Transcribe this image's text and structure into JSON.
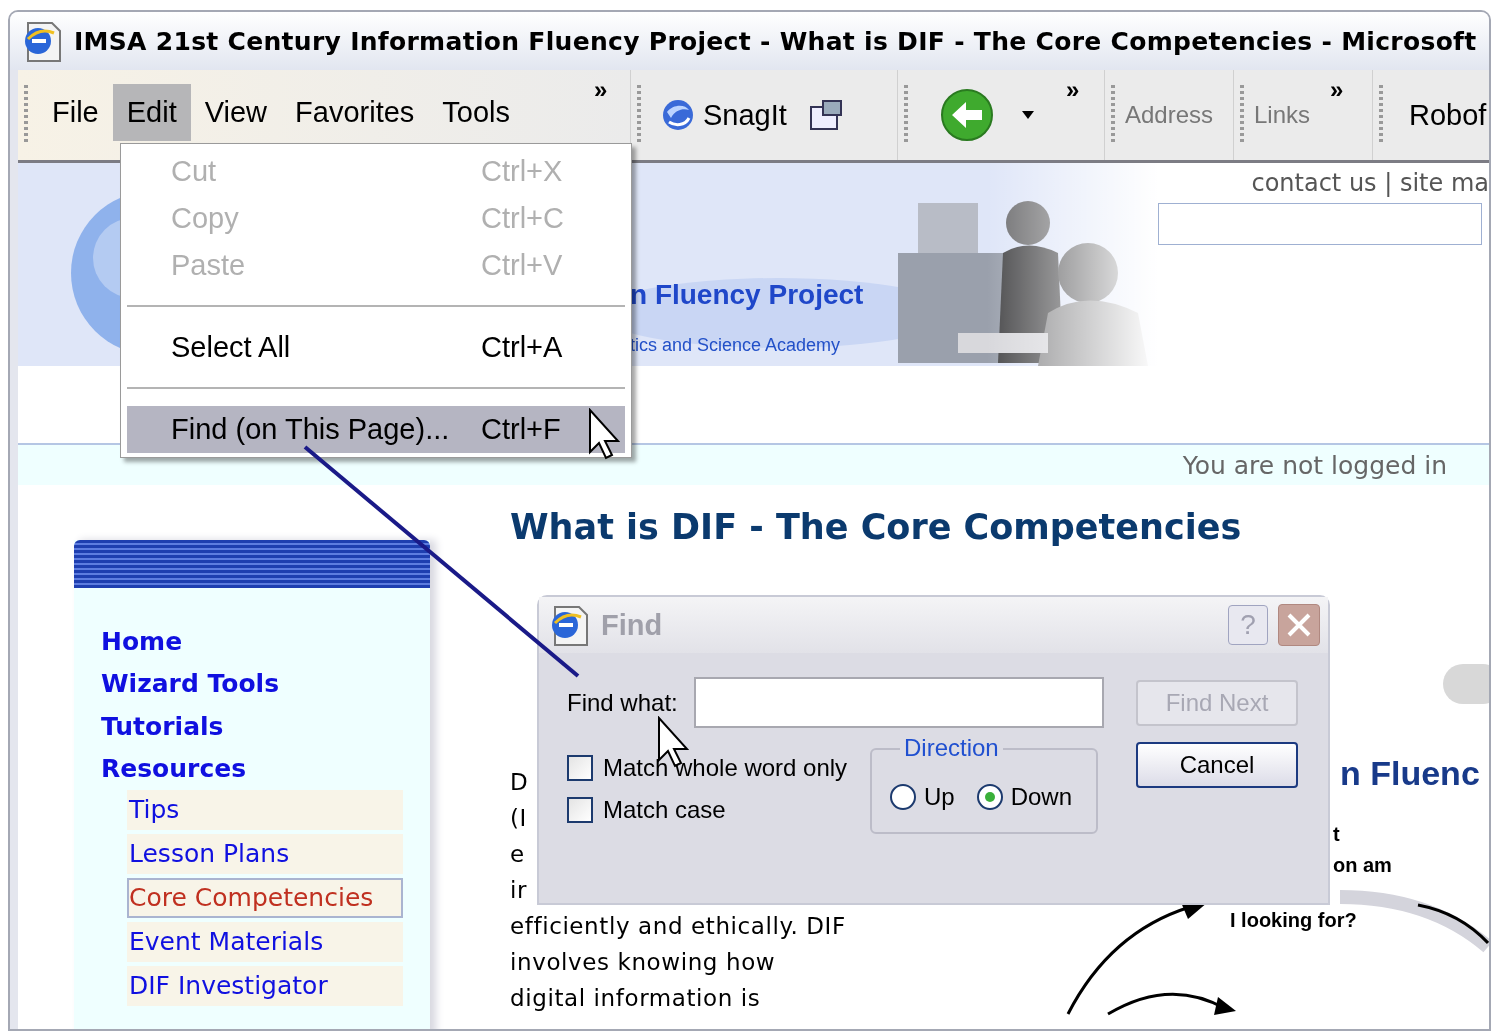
{
  "window": {
    "title": "IMSA 21st Century Information Fluency Project - What is DIF - The Core Competencies - Microsoft"
  },
  "menu_bar": {
    "items": [
      {
        "label": "File",
        "selected": false
      },
      {
        "label": "Edit",
        "selected": true
      },
      {
        "label": "View",
        "selected": false
      },
      {
        "label": "Favorites",
        "selected": false
      },
      {
        "label": "Tools",
        "selected": false
      }
    ],
    "overflow": "»"
  },
  "toolbar": {
    "snagit": "SnagIt",
    "back_overflow": "»",
    "address": "Address",
    "links": "Links",
    "links_overflow": "»",
    "next_band": "Robof"
  },
  "edit_menu": [
    {
      "kind": "item",
      "label": "Cut",
      "shortcut": "Ctrl+X",
      "disabled": true,
      "selected": false
    },
    {
      "kind": "item",
      "label": "Copy",
      "shortcut": "Ctrl+C",
      "disabled": true,
      "selected": false
    },
    {
      "kind": "item",
      "label": "Paste",
      "shortcut": "Ctrl+V",
      "disabled": true,
      "selected": false
    },
    {
      "kind": "separator"
    },
    {
      "kind": "item",
      "label": "Select All",
      "shortcut": "Ctrl+A",
      "disabled": false,
      "selected": false
    },
    {
      "kind": "separator"
    },
    {
      "kind": "item",
      "label": "Find (on This Page)...",
      "shortcut": "Ctrl+F",
      "disabled": false,
      "selected": true
    }
  ],
  "banner": {
    "title": "n Fluency Project",
    "subtitle": "tics and Science Academy",
    "top_links": "contact us | site ma"
  },
  "login_status": "You are not logged in",
  "sidebar": {
    "items": [
      {
        "label": "Home",
        "selected": false
      },
      {
        "label": "Wizard Tools",
        "selected": false
      },
      {
        "label": "Tutorials",
        "selected": false
      },
      {
        "label": "Resources",
        "selected": false,
        "children": [
          {
            "label": "Tips",
            "selected": false
          },
          {
            "label": "Lesson Plans",
            "selected": false
          },
          {
            "label": "Core Competencies",
            "selected": true
          },
          {
            "label": "Event Materials",
            "selected": false
          },
          {
            "label": "DIF Investigator",
            "selected": false
          }
        ]
      }
    ]
  },
  "article": {
    "heading": "What is DIF - The Core Competencies",
    "lines": [
      "D",
      "(I",
      "e",
      "ir",
      "efficiently and ethically. DIF",
      "involves knowing how",
      "digital information is"
    ]
  },
  "diagram": {
    "heading": "n Fluenc",
    "labels": [
      "t",
      "on am",
      "I looking for?"
    ]
  },
  "find_dialog": {
    "title": "Find",
    "help": "?",
    "find_label": "Find what:",
    "options": [
      {
        "label": "Match whole word only",
        "checked": false
      },
      {
        "label": "Match case",
        "checked": false
      }
    ],
    "direction": {
      "label": "Direction",
      "options": [
        {
          "label": "Up",
          "selected": false
        },
        {
          "label": "Down",
          "selected": true
        }
      ]
    },
    "buttons": [
      {
        "label": "Find Next",
        "disabled": true
      },
      {
        "label": "Cancel",
        "disabled": false
      }
    ]
  }
}
